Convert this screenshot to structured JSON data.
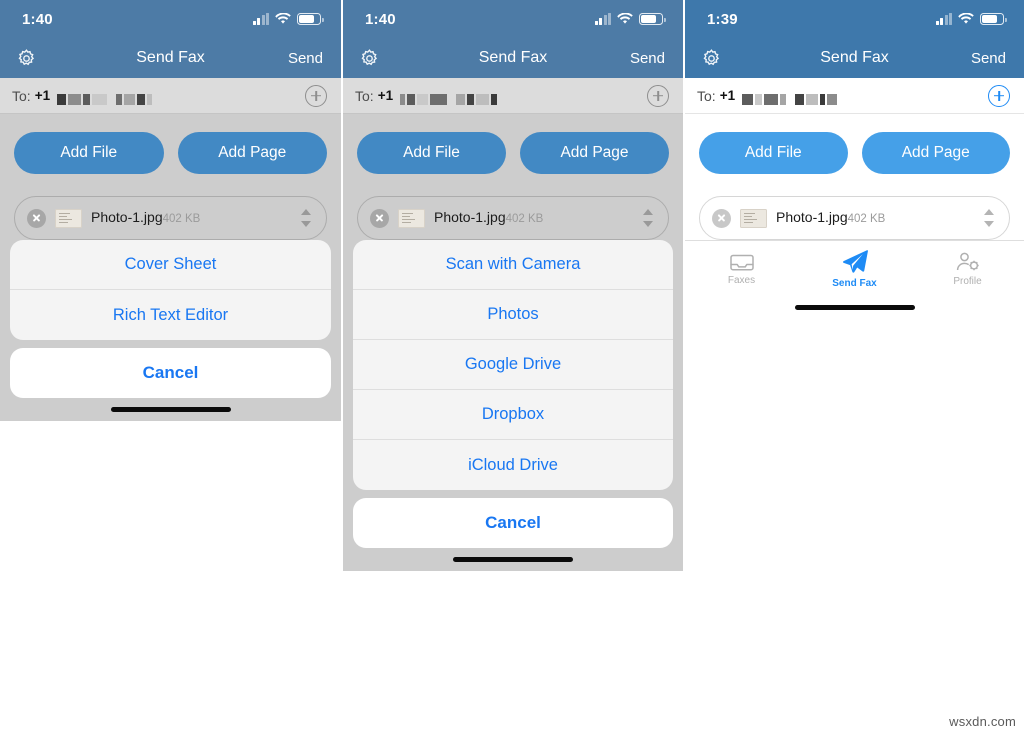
{
  "colors": {
    "nav_blue": "#3e78ab",
    "button_blue": "#45a0e8",
    "link_blue": "#1977f2",
    "tab_active": "#1e8bf5",
    "tab_inactive": "#b0b0b0",
    "dim_background": "#cdcdcd",
    "panel_background": "#ffffff"
  },
  "watermark": "wsxdn.com",
  "panels": [
    {
      "id": "panel-left",
      "dimmed": true,
      "status_bar": {
        "clock": "1:40",
        "cellular_icon": "cellular-bars-icon",
        "wifi_icon": "wifi-icon",
        "battery_icon": "battery-icon"
      },
      "nav": {
        "settings_icon": "gear-icon",
        "title": "Send Fax",
        "send_label": "Send"
      },
      "to_field": {
        "label": "To:",
        "country_code": "+1",
        "number_redacted": true,
        "add_contact_icon": "plus-circle-icon"
      },
      "actions": {
        "add_file": "Add File",
        "add_page": "Add Page"
      },
      "file": {
        "name": "Photo-1.jpg",
        "size": "402 KB",
        "remove_icon": "remove-circle-icon",
        "thumbnail_icon": "document-thumbnail-icon",
        "reorder_icon": "stepper-up-down-icon"
      },
      "sheet": {
        "items": [
          "Cover Sheet",
          "Rich Text Editor"
        ],
        "cancel": "Cancel"
      },
      "tab_bar": null
    },
    {
      "id": "panel-middle",
      "dimmed": true,
      "status_bar": {
        "clock": "1:40",
        "cellular_icon": "cellular-bars-icon",
        "wifi_icon": "wifi-icon",
        "battery_icon": "battery-icon"
      },
      "nav": {
        "settings_icon": "gear-icon",
        "title": "Send Fax",
        "send_label": "Send"
      },
      "to_field": {
        "label": "To:",
        "country_code": "+1",
        "number_redacted": true,
        "add_contact_icon": "plus-circle-icon"
      },
      "actions": {
        "add_file": "Add File",
        "add_page": "Add Page"
      },
      "file": {
        "name": "Photo-1.jpg",
        "size": "402 KB",
        "remove_icon": "remove-circle-icon",
        "thumbnail_icon": "document-thumbnail-icon",
        "reorder_icon": "stepper-up-down-icon"
      },
      "sheet": {
        "items": [
          "Scan with Camera",
          "Photos",
          "Google Drive",
          "Dropbox",
          "iCloud Drive"
        ],
        "cancel": "Cancel"
      },
      "tab_bar": null
    },
    {
      "id": "panel-right",
      "dimmed": false,
      "status_bar": {
        "clock": "1:39",
        "cellular_icon": "cellular-bars-icon",
        "wifi_icon": "wifi-icon",
        "battery_icon": "battery-icon"
      },
      "nav": {
        "settings_icon": "gear-icon",
        "title": "Send Fax",
        "send_label": "Send"
      },
      "to_field": {
        "label": "To:",
        "country_code": "+1",
        "number_redacted": true,
        "add_contact_icon": "plus-circle-icon"
      },
      "actions": {
        "add_file": "Add File",
        "add_page": "Add Page"
      },
      "file": {
        "name": "Photo-1.jpg",
        "size": "402 KB",
        "remove_icon": "remove-circle-icon",
        "thumbnail_icon": "document-thumbnail-icon",
        "reorder_icon": "stepper-up-down-icon"
      },
      "sheet": null,
      "tab_bar": {
        "items": [
          {
            "label": "Faxes",
            "icon": "inbox-tray-icon",
            "active": false
          },
          {
            "label": "Send Fax",
            "icon": "paper-plane-icon",
            "active": true
          },
          {
            "label": "Profile",
            "icon": "person-gear-icon",
            "active": false
          }
        ]
      }
    }
  ]
}
